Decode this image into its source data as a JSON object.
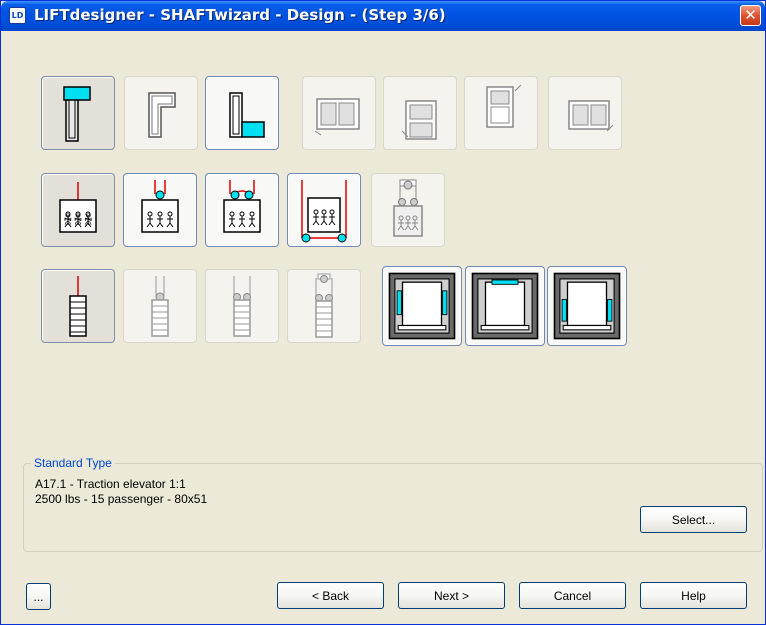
{
  "window": {
    "title": "LIFTdesigner - SHAFTwizard - Design - (Step 3/6)",
    "icon_text": "LD",
    "close_glyph": "✕"
  },
  "row1": [
    {
      "name": "shaft-layout-counterweight-side-front-option",
      "state": "selected"
    },
    {
      "name": "shaft-layout-counterweight-side-front-alt-option",
      "state": "normal"
    },
    {
      "name": "shaft-layout-counterweight-side-rear-option",
      "state": "active"
    },
    {
      "name": "shaft-layout-double-door-option",
      "state": "disabled"
    },
    {
      "name": "shaft-layout-through-door-option",
      "state": "disabled"
    },
    {
      "name": "shaft-layout-adjacent-door-option",
      "state": "disabled"
    },
    {
      "name": "shaft-layout-side-by-side-option",
      "state": "disabled"
    }
  ],
  "row2": [
    {
      "name": "roping-1to1-option",
      "state": "selected"
    },
    {
      "name": "roping-2to1-overhead-option",
      "state": "active"
    },
    {
      "name": "roping-2to1-double-pulley-option",
      "state": "active"
    },
    {
      "name": "roping-underslung-option",
      "state": "active"
    },
    {
      "name": "roping-4to1-option",
      "state": "disabled"
    }
  ],
  "row3": [
    {
      "name": "counterweight-1to1-option",
      "state": "selected"
    },
    {
      "name": "counterweight-2to1-option",
      "state": "disabled"
    },
    {
      "name": "counterweight-2to1-double-option",
      "state": "disabled"
    },
    {
      "name": "counterweight-4to1-option",
      "state": "disabled"
    },
    {
      "name": "car-door-side-rails-option",
      "state": "active"
    },
    {
      "name": "car-door-rear-rails-option",
      "state": "active"
    },
    {
      "name": "car-door-center-option",
      "state": "active"
    }
  ],
  "standard_type": {
    "label": "Standard Type",
    "line1": "A17.1 - Traction elevator 1:1",
    "line2": "2500 lbs - 15 passenger - 80x51",
    "select_label": "Select..."
  },
  "buttons": {
    "more": "...",
    "back": "< Back",
    "next": "Next >",
    "cancel": "Cancel",
    "help": "Help"
  },
  "colors": {
    "accent_cyan": "#00E0F0",
    "rope_red": "#E00000",
    "titlebar_blue": "#0054E3",
    "group_label_blue": "#0046D5"
  }
}
